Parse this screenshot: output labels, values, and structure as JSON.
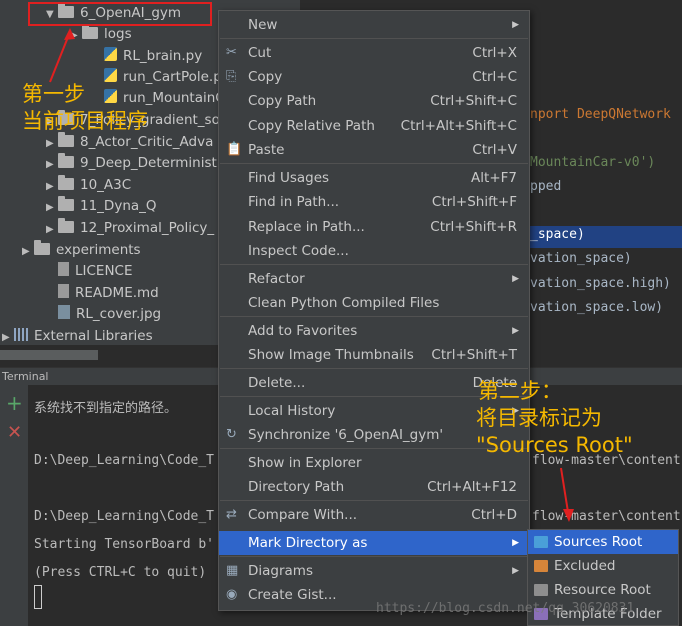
{
  "project_tree": {
    "items": [
      {
        "label": "6_OpenAI_gym",
        "type": "folder",
        "indent": 1,
        "arrow": "▼"
      },
      {
        "label": "logs",
        "type": "folder",
        "indent": 2,
        "arrow": "▶"
      },
      {
        "label": "RL_brain.py",
        "type": "py",
        "indent": 3,
        "arrow": ""
      },
      {
        "label": "run_CartPole.py",
        "type": "py",
        "indent": 3,
        "arrow": ""
      },
      {
        "label": "run_MountainCar",
        "type": "py",
        "indent": 3,
        "arrow": ""
      },
      {
        "label": "7_Policy_gradient_so",
        "type": "folder",
        "indent": 1,
        "arrow": "▶"
      },
      {
        "label": "8_Actor_Critic_Adva",
        "type": "folder",
        "indent": 1,
        "arrow": "▶"
      },
      {
        "label": "9_Deep_Determinist",
        "type": "folder",
        "indent": 1,
        "arrow": "▶"
      },
      {
        "label": "10_A3C",
        "type": "folder",
        "indent": 1,
        "arrow": "▶"
      },
      {
        "label": "11_Dyna_Q",
        "type": "folder",
        "indent": 1,
        "arrow": "▶"
      },
      {
        "label": "12_Proximal_Policy_",
        "type": "folder",
        "indent": 1,
        "arrow": "▶"
      },
      {
        "label": "experiments",
        "type": "folder",
        "indent": 0,
        "arrow": "▶"
      },
      {
        "label": "LICENCE",
        "type": "file",
        "indent": 1,
        "arrow": ""
      },
      {
        "label": "README.md",
        "type": "file",
        "indent": 1,
        "arrow": ""
      },
      {
        "label": "RL_cover.jpg",
        "type": "img",
        "indent": 1,
        "arrow": ""
      },
      {
        "label": "External Libraries",
        "type": "lib",
        "indent": -1,
        "arrow": "▶"
      }
    ]
  },
  "code_lines": [
    "nport DeepQNetwork",
    "MountainCar-v0')",
    "pped",
    "_space)",
    "vation_space)",
    "vation_space.high)",
    "vation_space.low)"
  ],
  "terminal": {
    "title": "Terminal",
    "lines": [
      "系统找不到指定的路径。",
      "D:\\Deep_Learning\\Code_T",
      "D:\\Deep_Learning\\Code_T",
      "Starting TensorBoard b'",
      "(Press CTRL+C to quit)"
    ],
    "right_fragments": [
      "flow-master\\content",
      "flow-master\\content"
    ]
  },
  "context_menu": {
    "items": [
      {
        "label": "New",
        "shortcut": "",
        "submenu": true,
        "icon": ""
      },
      {
        "label": "Cut",
        "shortcut": "Ctrl+X",
        "submenu": false,
        "icon": "✂"
      },
      {
        "label": "Copy",
        "shortcut": "Ctrl+C",
        "submenu": false,
        "icon": "⎘"
      },
      {
        "label": "Copy Path",
        "shortcut": "Ctrl+Shift+C",
        "submenu": false,
        "icon": ""
      },
      {
        "label": "Copy Relative Path",
        "shortcut": "Ctrl+Alt+Shift+C",
        "submenu": false,
        "icon": ""
      },
      {
        "label": "Paste",
        "shortcut": "Ctrl+V",
        "submenu": false,
        "icon": "📋"
      },
      {
        "label": "Find Usages",
        "shortcut": "Alt+F7",
        "submenu": false,
        "icon": ""
      },
      {
        "label": "Find in Path...",
        "shortcut": "Ctrl+Shift+F",
        "submenu": false,
        "icon": ""
      },
      {
        "label": "Replace in Path...",
        "shortcut": "Ctrl+Shift+R",
        "submenu": false,
        "icon": ""
      },
      {
        "label": "Inspect Code...",
        "shortcut": "",
        "submenu": false,
        "icon": ""
      },
      {
        "label": "Refactor",
        "shortcut": "",
        "submenu": true,
        "icon": ""
      },
      {
        "label": "Clean Python Compiled Files",
        "shortcut": "",
        "submenu": false,
        "icon": ""
      },
      {
        "label": "Add to Favorites",
        "shortcut": "",
        "submenu": true,
        "icon": ""
      },
      {
        "label": "Show Image Thumbnails",
        "shortcut": "Ctrl+Shift+T",
        "submenu": false,
        "icon": ""
      },
      {
        "label": "Delete...",
        "shortcut": "Delete",
        "submenu": false,
        "icon": ""
      },
      {
        "label": "Local History",
        "shortcut": "",
        "submenu": true,
        "icon": ""
      },
      {
        "label": "Synchronize '6_OpenAI_gym'",
        "shortcut": "",
        "submenu": false,
        "icon": "↻"
      },
      {
        "label": "Show in Explorer",
        "shortcut": "",
        "submenu": false,
        "icon": ""
      },
      {
        "label": "Directory Path",
        "shortcut": "Ctrl+Alt+F12",
        "submenu": false,
        "icon": ""
      },
      {
        "label": "Compare With...",
        "shortcut": "Ctrl+D",
        "submenu": false,
        "icon": "⇄"
      },
      {
        "label": "Mark Directory as",
        "shortcut": "",
        "submenu": true,
        "icon": "",
        "active": true
      },
      {
        "label": "Diagrams",
        "shortcut": "",
        "submenu": true,
        "icon": "▦"
      },
      {
        "label": "Create Gist...",
        "shortcut": "",
        "submenu": false,
        "icon": "◉"
      }
    ]
  },
  "submenu": {
    "items": [
      {
        "label": "Sources Root",
        "color": "#4a9fd8",
        "active": true
      },
      {
        "label": "Excluded",
        "color": "#d6853a",
        "active": false
      },
      {
        "label": "Resource Root",
        "color": "#8e8e8e",
        "active": false
      },
      {
        "label": "Template Folder",
        "color": "#8a6fb8",
        "active": false
      }
    ]
  },
  "annotations": {
    "step1_line1": "第一步",
    "step1_line2": "当前项目程序",
    "step2_line1": "第二步：",
    "step2_line2": "将目录标记为",
    "step2_line3": "\"Sources Root\""
  },
  "watermark": "https://blog.csdn.net/qq_30620831",
  "colors": {
    "accent": "#2f65ca",
    "annotation": "#f5b800",
    "highlight_box": "#e02020"
  }
}
